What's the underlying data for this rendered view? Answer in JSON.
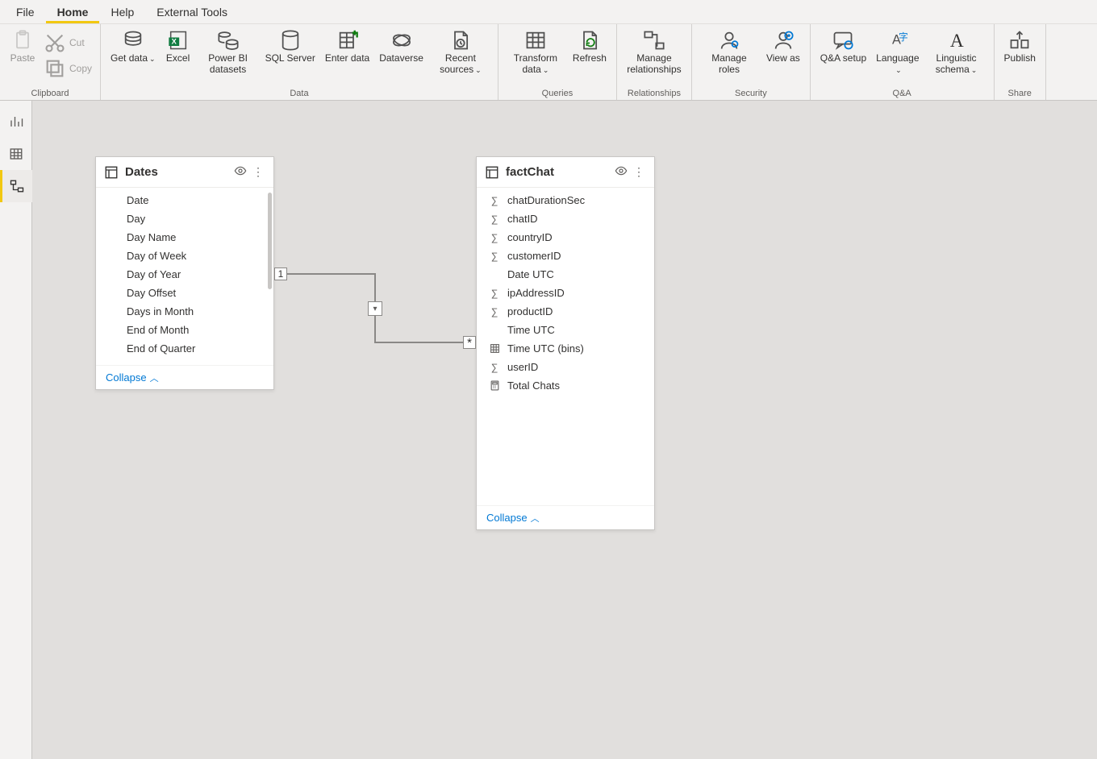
{
  "menubar": {
    "items": [
      {
        "label": "File"
      },
      {
        "label": "Home",
        "active": true
      },
      {
        "label": "Help"
      },
      {
        "label": "External Tools"
      }
    ]
  },
  "ribbon": {
    "groups": [
      {
        "label": "Clipboard",
        "items": [
          {
            "label": "Paste"
          },
          {
            "label": "Cut"
          },
          {
            "label": "Copy"
          }
        ]
      },
      {
        "label": "Data",
        "items": [
          {
            "label": "Get data",
            "dropdown": true
          },
          {
            "label": "Excel"
          },
          {
            "label": "Power BI datasets"
          },
          {
            "label": "SQL Server"
          },
          {
            "label": "Enter data"
          },
          {
            "label": "Dataverse"
          },
          {
            "label": "Recent sources",
            "dropdown": true
          }
        ]
      },
      {
        "label": "Queries",
        "items": [
          {
            "label": "Transform data",
            "dropdown": true
          },
          {
            "label": "Refresh"
          }
        ]
      },
      {
        "label": "Relationships",
        "items": [
          {
            "label": "Manage relationships"
          }
        ]
      },
      {
        "label": "Security",
        "items": [
          {
            "label": "Manage roles"
          },
          {
            "label": "View as"
          }
        ]
      },
      {
        "label": "Q&A",
        "items": [
          {
            "label": "Q&A setup"
          },
          {
            "label": "Language",
            "dropdown": true
          },
          {
            "label": "Linguistic schema",
            "dropdown": true
          }
        ]
      },
      {
        "label": "Share",
        "items": [
          {
            "label": "Publish"
          }
        ]
      }
    ]
  },
  "rail": {
    "active_index": 2
  },
  "tables": {
    "dates": {
      "title": "Dates",
      "collapse_label": "Collapse",
      "fields": [
        {
          "name": "Date"
        },
        {
          "name": "Day"
        },
        {
          "name": "Day Name"
        },
        {
          "name": "Day of Week"
        },
        {
          "name": "Day of Year"
        },
        {
          "name": "Day Offset"
        },
        {
          "name": "Days in Month"
        },
        {
          "name": "End of Month"
        },
        {
          "name": "End of Quarter"
        }
      ]
    },
    "factchat": {
      "title": "factChat",
      "collapse_label": "Collapse",
      "fields": [
        {
          "name": "chatDurationSec",
          "icon": "sigma"
        },
        {
          "name": "chatID",
          "icon": "sigma"
        },
        {
          "name": "countryID",
          "icon": "sigma"
        },
        {
          "name": "customerID",
          "icon": "sigma"
        },
        {
          "name": "Date UTC"
        },
        {
          "name": "ipAddressID",
          "icon": "sigma"
        },
        {
          "name": "productID",
          "icon": "sigma"
        },
        {
          "name": "Time UTC"
        },
        {
          "name": "Time UTC (bins)",
          "icon": "bins"
        },
        {
          "name": "userID",
          "icon": "sigma"
        },
        {
          "name": "Total Chats",
          "icon": "calc"
        }
      ]
    }
  },
  "relationship": {
    "from_card": "1",
    "to_card": "*"
  }
}
